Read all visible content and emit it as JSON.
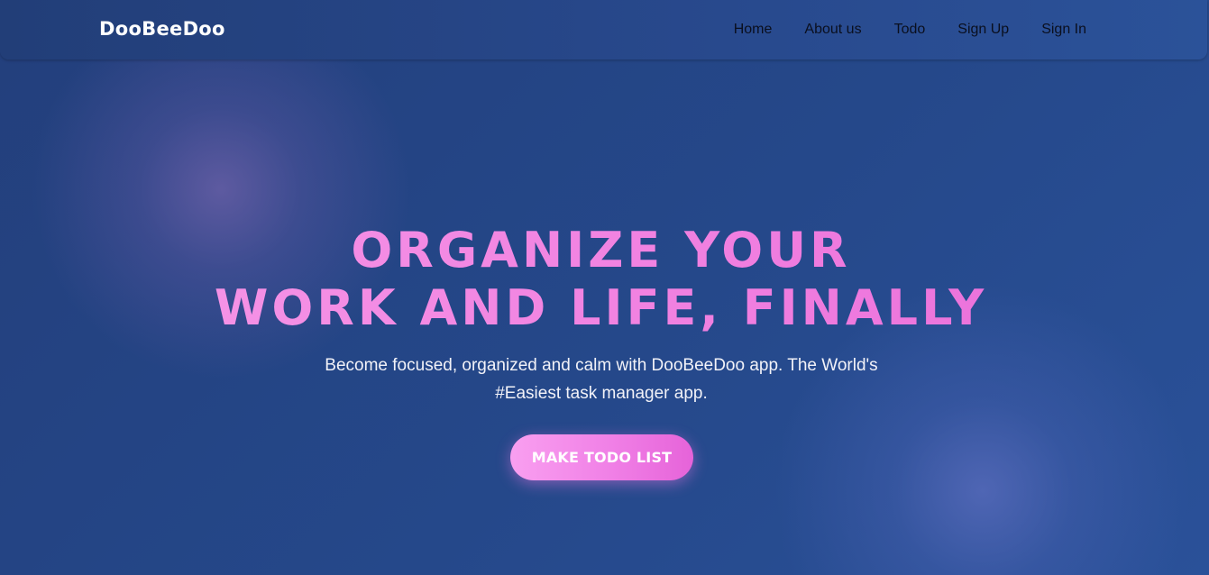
{
  "navbar": {
    "brand": "DooBeeDoo",
    "links": [
      "Home",
      "About us",
      "Todo",
      "Sign Up",
      "Sign In"
    ]
  },
  "hero": {
    "headline_line1": "ORGANIZE YOUR",
    "headline_line2": "WORK AND LIFE, FINALLY",
    "subtitle": "Become focused, organized and calm with DooBeeDoo app. The World's #Easiest task manager app.",
    "cta_label": "MAKE TODO LIST"
  },
  "colors": {
    "background": "#244583",
    "headline": "#f07fe0",
    "button": "#f080e6",
    "text": "#ffffff"
  }
}
